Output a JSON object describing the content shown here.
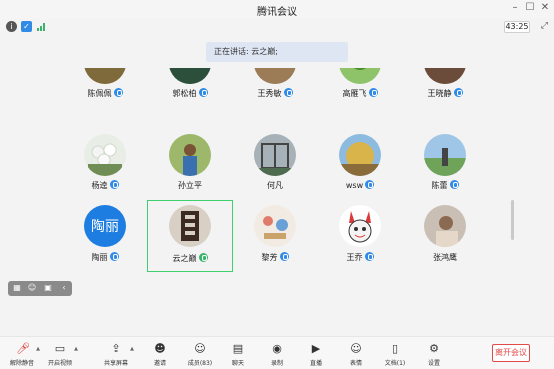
{
  "window": {
    "title": "腾讯会议",
    "controls": [
      "minimize-icon",
      "maximize-icon",
      "close-icon"
    ]
  },
  "infobar": {
    "icons": [
      "info-icon",
      "shield-icon",
      "signal-icon"
    ],
    "timer": "43:25"
  },
  "speaking_banner": "正在讲话: 云之巅;",
  "participants": [
    {
      "name": "陈佩佩",
      "mic": "mic-icon",
      "avatar": "photo"
    },
    {
      "name": "郭松柏",
      "mic": "mic-icon",
      "avatar": "photo"
    },
    {
      "name": "王秀敏",
      "mic": "mic-icon",
      "avatar": "photo"
    },
    {
      "name": "高雁飞",
      "mic": "mic-icon",
      "avatar": "photo"
    },
    {
      "name": "王晓静",
      "mic": "mic-icon",
      "avatar": "photo"
    },
    {
      "name": "杨逵",
      "mic": "mic-icon",
      "avatar": "photo"
    },
    {
      "name": "孙立平",
      "mic": "",
      "avatar": "photo"
    },
    {
      "name": "何凡",
      "mic": "",
      "avatar": "photo"
    },
    {
      "name": "wsw",
      "mic": "mic-icon",
      "avatar": "photo"
    },
    {
      "name": "陈蕾",
      "mic": "mic-icon",
      "avatar": "photo"
    },
    {
      "name": "陶丽",
      "mic": "mic-icon",
      "avatar": "text",
      "avatar_text": "陶丽"
    },
    {
      "name": "云之巅",
      "mic": "mic-active-icon",
      "avatar": "photo",
      "active": true
    },
    {
      "name": "黎芳",
      "mic": "mic-icon",
      "avatar": "photo"
    },
    {
      "name": "王乔",
      "mic": "mic-icon",
      "avatar": "photo"
    },
    {
      "name": "张鸿鹰",
      "mic": "",
      "avatar": "photo"
    }
  ],
  "mini_tools": [
    "grid-view-icon",
    "person-icon",
    "gallery-icon",
    "collapse-icon"
  ],
  "toolbar": {
    "buttons": [
      {
        "label": "解除静音",
        "icon": "mic-muted-icon"
      },
      {
        "label": "开启视频",
        "icon": "video-off-icon"
      },
      {
        "label": "共享屏幕",
        "icon": "screen-share-icon"
      },
      {
        "label": "邀请",
        "icon": "invite-icon"
      },
      {
        "label": "成员(83)",
        "icon": "members-icon"
      },
      {
        "label": "聊天",
        "icon": "chat-icon"
      },
      {
        "label": "录制",
        "icon": "record-icon"
      },
      {
        "label": "直播",
        "icon": "live-icon"
      },
      {
        "label": "表情",
        "icon": "emoji-icon"
      },
      {
        "label": "文档(1)",
        "icon": "document-icon"
      },
      {
        "label": "设置",
        "icon": "settings-icon"
      }
    ],
    "leave_label": "离开会议"
  },
  "colors": {
    "accent_blue": "#2f8be6",
    "active_green": "#3ecf6f",
    "leave_red": "#e34b4b",
    "text_avatar_bg": "#1e7de0"
  }
}
